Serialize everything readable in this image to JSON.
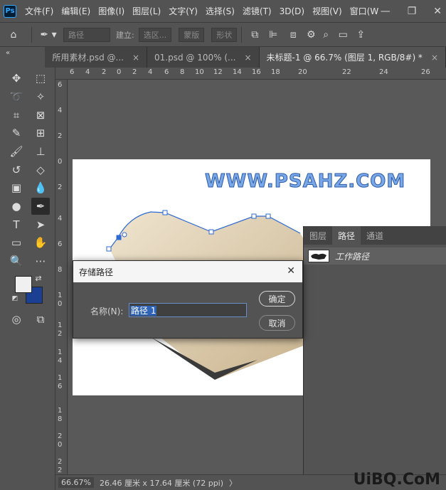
{
  "app": {
    "logo": "Ps"
  },
  "menubar": {
    "items": [
      "文件(F)",
      "编辑(E)",
      "图像(I)",
      "图层(L)",
      "文字(Y)",
      "选择(S)",
      "滤镜(T)",
      "3D(D)",
      "视图(V)",
      "窗口(W"
    ]
  },
  "optionsbar": {
    "mode_value": "路径",
    "make_label": "建立:",
    "selection_btn": "选区...",
    "mask_btn": "蒙版",
    "shape_btn": "形状"
  },
  "tabs": [
    {
      "label": "所用素材.psd @...",
      "close": "×",
      "active": false
    },
    {
      "label": "01.psd @ 100% (...",
      "close": "×",
      "active": false
    },
    {
      "label": "未标题-1 @ 66.7% (图层 1, RGB/8#) *",
      "close": "×",
      "active": true
    }
  ],
  "tab_collapse": "«",
  "ruler_top": [
    "6",
    "4",
    "2",
    "0",
    "2",
    "4",
    "6",
    "8",
    "10",
    "12",
    "14",
    "16",
    "18",
    "20",
    "22",
    "24",
    "26"
  ],
  "ruler_left": [
    "6",
    "4",
    "2",
    "0",
    "2",
    "4",
    "6",
    "8",
    "1",
    "0",
    "1",
    "2",
    "1",
    "4",
    "1",
    "6",
    "1",
    "8",
    "2",
    "0",
    "2",
    "2"
  ],
  "canvas": {
    "watermark": "WWW.PSAHZ.COM"
  },
  "panel": {
    "tabs": [
      "图层",
      "路径",
      "通道"
    ],
    "active_tab": "路径",
    "path_item": "工作路径"
  },
  "dialog": {
    "title": "存储路径",
    "close": "✕",
    "name_label": "名称(N):",
    "name_value": "路径 1",
    "ok_label": "确定",
    "cancel_label": "取消"
  },
  "status": {
    "zoom": "66.67%",
    "doc_size": "26.46 厘米 x 17.64 厘米 (72 ppi)",
    "arrow": "〉"
  },
  "brand_watermark": "UiBQ.CoM",
  "colors": {
    "foreground": "#f0f0f0",
    "background": "#1b3f93",
    "accent": "#2e63b8"
  }
}
